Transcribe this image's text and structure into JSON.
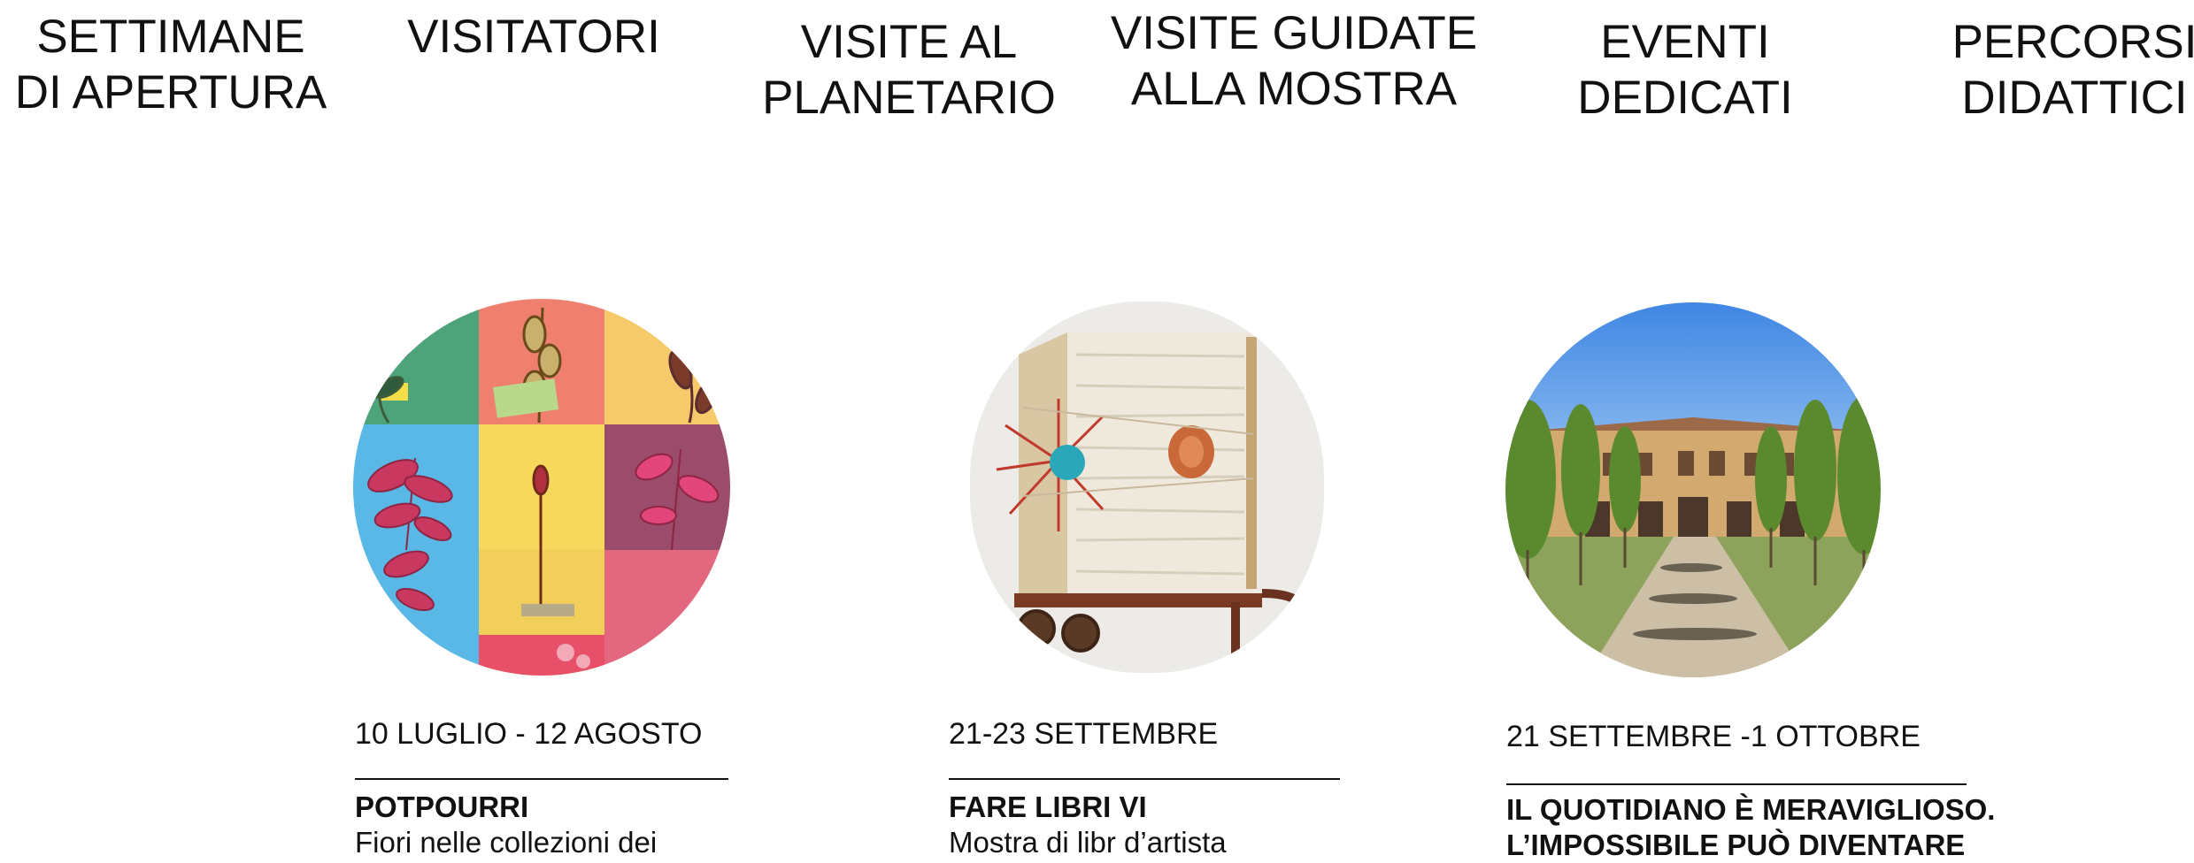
{
  "stats": [
    {
      "number": "",
      "label": "SETTIMANE\nDI APERTURA"
    },
    {
      "number": "",
      "label": "VISITATORI"
    },
    {
      "number": "",
      "label": "VISITE AL\nPLANETARIO"
    },
    {
      "number": "",
      "label": "VISITE GUIDATE\nALLA MOSTRA"
    },
    {
      "number": "",
      "label": "EVENTI\nDEDICATI"
    },
    {
      "number": "",
      "label": "PERCORSI\nDIDATTICI"
    }
  ],
  "events": [
    {
      "date": "10 LUGLIO - 12 AGOSTO",
      "title": "POTPOURRI",
      "subtitle": "Fiori nelle collezioni dei",
      "image": "botanical-collage-image"
    },
    {
      "date": "21-23 SETTEMBRE",
      "title": "FARE LIBRI VI",
      "subtitle": "Mostra di libr d’artista",
      "image": "artist-book-image"
    },
    {
      "date": "21 SETTEMBRE -1 OTTOBRE",
      "title": "IL QUOTIDIANO È MERAVIGLIOSO.\nL’IMPOSSIBILE PUÒ DIVENTARE",
      "subtitle": "",
      "image": "villa-courtyard-image"
    }
  ],
  "colors": {
    "text": "#111111",
    "background": "#ffffff"
  }
}
